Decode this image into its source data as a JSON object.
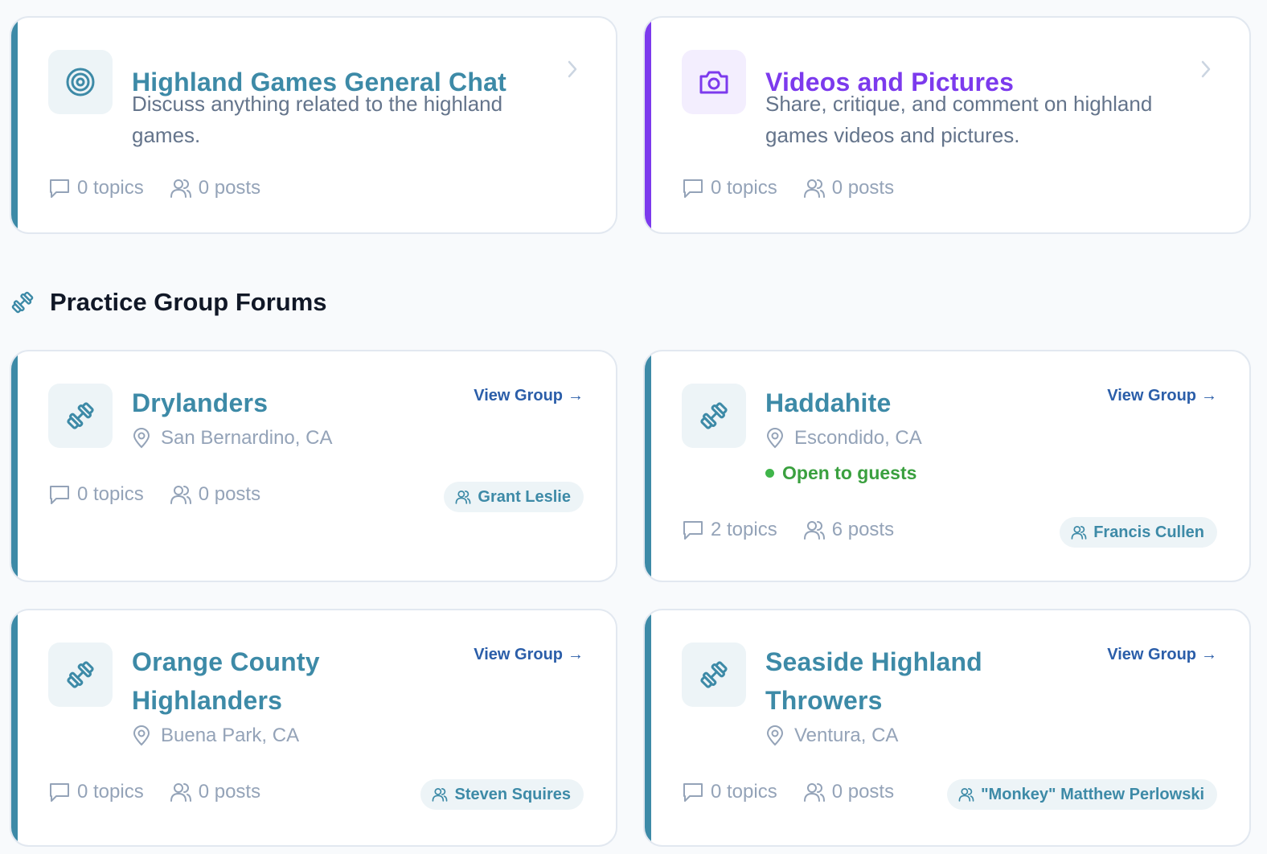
{
  "colors": {
    "teal": "#3d8aa7",
    "purple": "#7c3aed",
    "link_blue": "#2b5ea9",
    "guest_green": "#3aa03f",
    "muted": "#94a3b8"
  },
  "general_forums": [
    {
      "title": "Highland Games General Chat",
      "description": "Discuss anything related to the highland games.",
      "icon": "target-icon",
      "topics": "0 topics",
      "posts": "0 posts"
    },
    {
      "title": "Videos and Pictures",
      "description": "Share, critique, and comment on highland games videos and pictures.",
      "icon": "camera-icon",
      "topics": "0 topics",
      "posts": "0 posts"
    }
  ],
  "section": {
    "title": "Practice Group Forums",
    "icon": "dumbbell-icon"
  },
  "groups": [
    {
      "name": "Drylanders",
      "location": "San Bernardino, CA",
      "topics": "0 topics",
      "posts": "0 posts",
      "leader": "Grant Leslie",
      "view_label": "View Group",
      "arrow": "→"
    },
    {
      "name": "Haddahite",
      "location": "Escondido, CA",
      "guest_status": "Open to guests",
      "topics": "2 topics",
      "posts": "6 posts",
      "leader": "Francis Cullen",
      "view_label": "View Group",
      "arrow": "→"
    },
    {
      "name_line1": "Orange County",
      "name_line2": "Highlanders",
      "location": "Buena Park, CA",
      "topics": "0 topics",
      "posts": "0 posts",
      "leader": "Steven Squires",
      "view_label": "View Group",
      "arrow": "→"
    },
    {
      "name_line1": "Seaside Highland",
      "name_line2": "Throwers",
      "location": "Ventura, CA",
      "topics": "0 topics",
      "posts": "0 posts",
      "leader": "\"Monkey\" Matthew Perlowski",
      "view_label": "View Group",
      "arrow": "→"
    }
  ]
}
